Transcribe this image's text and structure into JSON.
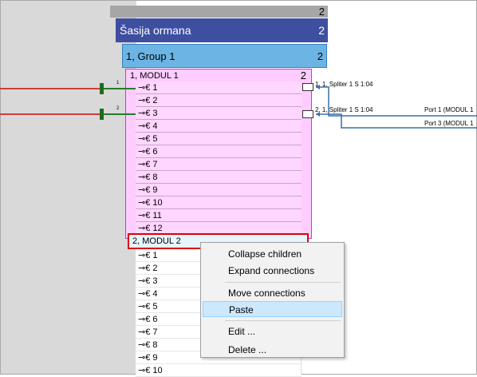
{
  "rack": {
    "number": "2"
  },
  "chassis": {
    "label": "Šasija ormana",
    "number": "2"
  },
  "group": {
    "label": "1, Group 1",
    "number": "2"
  },
  "modul1": {
    "label": "1, MODUL 1",
    "number": "2",
    "ports": [
      "1",
      "2",
      "3",
      "4",
      "5",
      "6",
      "7",
      "8",
      "9",
      "10",
      "11",
      "12"
    ]
  },
  "modul2": {
    "label": "2, MODUL 2",
    "ports": [
      "1",
      "2",
      "3",
      "4",
      "5",
      "6",
      "7",
      "8",
      "9",
      "10"
    ]
  },
  "left_cables": [
    {
      "label": "1"
    },
    {
      "label": "2"
    }
  ],
  "splitter_labels": [
    "1, 1, Spliter 1 S 1:04",
    "2, 1, Spliter 1 S 1:04"
  ],
  "right_ports": [
    "Port 1 (MODUL 1",
    "Port 3 (MODUL 1"
  ],
  "context_menu": {
    "items": [
      "Collapse children",
      "Expand connections",
      "Move connections",
      "Paste",
      "Edit ...",
      "Delete ..."
    ],
    "highlighted": "Paste"
  },
  "icons": {
    "port": "port-plug-icon"
  },
  "colors": {
    "chassis": "#3f4fa0",
    "group": "#6cb4e4",
    "modul": "#ffccff",
    "selection": "#e00000",
    "cable": "#d23b3b",
    "link": "#3b6ea8"
  }
}
